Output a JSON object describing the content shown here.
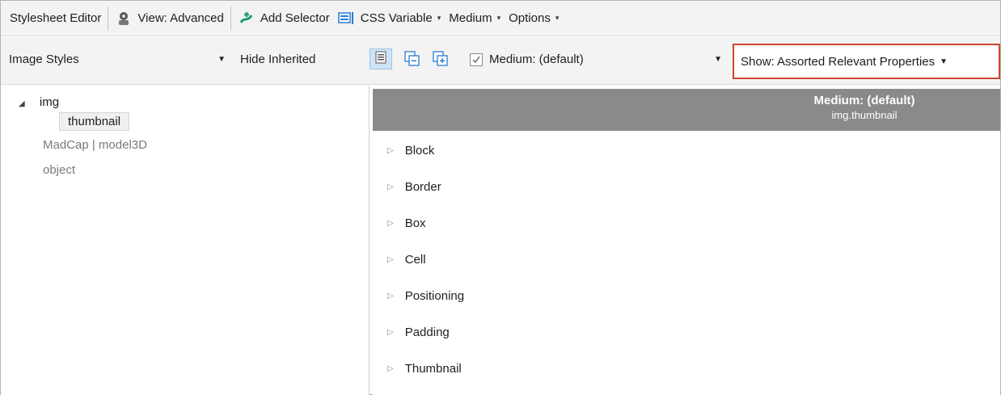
{
  "toolbar1": {
    "title": "Stylesheet Editor",
    "view": "View: Advanced",
    "add_selector": "Add Selector",
    "css_variable": "CSS Variable",
    "medium": "Medium",
    "options": "Options"
  },
  "toolbar2": {
    "style_select": "Image Styles",
    "hide_inherited": "Hide Inherited",
    "medium_select": "Medium: (default)",
    "show_select": "Show: Assorted Relevant Properties"
  },
  "tree": {
    "items": [
      {
        "label": "img"
      },
      {
        "label": "thumbnail"
      },
      {
        "label": "MadCap | model3D"
      },
      {
        "label": "object"
      }
    ]
  },
  "panel": {
    "header_title": "Medium: (default)",
    "header_sub": "img.thumbnail",
    "groups": [
      {
        "label": "Block"
      },
      {
        "label": "Border"
      },
      {
        "label": "Box"
      },
      {
        "label": "Cell"
      },
      {
        "label": "Positioning"
      },
      {
        "label": "Padding"
      },
      {
        "label": "Thumbnail"
      }
    ]
  },
  "colors": {
    "accent_border": "#d0462c",
    "header_bg": "#8a8a8a",
    "icon_blue": "#2b7cd3",
    "icon_green": "#1a9e6a"
  },
  "icons": [
    "view-eye-icon",
    "add-selector-icon",
    "css-variable-icon",
    "show-properties-icon",
    "collapse-icon",
    "expand-icon"
  ]
}
